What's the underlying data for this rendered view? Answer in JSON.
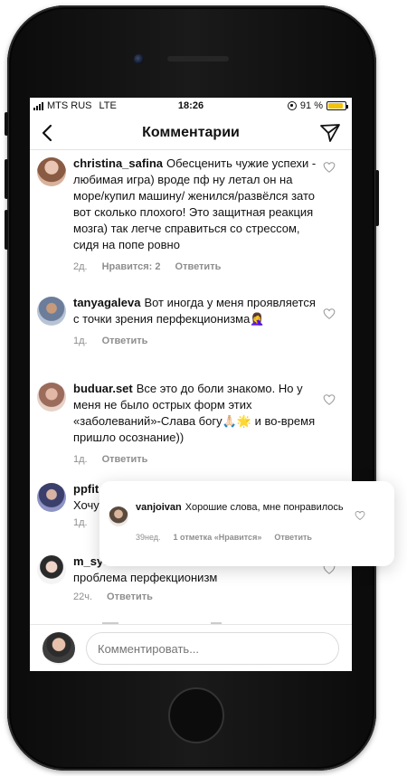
{
  "status_bar": {
    "carrier": "MTS RUS",
    "network": "LTE",
    "time": "18:26",
    "battery": "91 %",
    "battery_level": 0.91
  },
  "header": {
    "title": "Комментарии"
  },
  "comments": [
    {
      "username": "christina_safina",
      "text": "Обесценить чужие успехи - любимая игра) вроде пф ну летал он на море/купил машину/ женился/развёлся зато вот сколько плохого! Это защитная реакция мозга) так легче справиться со стрессом, сидя на попе ровно",
      "time": "2д.",
      "likes": "Нравится: 2",
      "reply": "Ответить"
    },
    {
      "username": "tanyagaleva",
      "text": "Вот иногда у меня проявляется с точки зрения перфекционизма🤦‍♀️",
      "time": "1д.",
      "reply": "Ответить"
    },
    {
      "username": "buduar.set",
      "text": "Все это до боли знакомо. Но у меня не было острых форм этих «заболеваний»-Слава богу🙏🏻🌟 и во-время пришло осознание))",
      "time": "1д.",
      "reply": "Ответить"
    },
    {
      "username": "ppfit",
      "text": "Хочу",
      "time": "1д."
    },
    {
      "username": "m_sych",
      "text": "проблема перфекционизм",
      "time": "22ч.",
      "reply": "Ответить"
    }
  ],
  "popup": {
    "username": "vanjoivan",
    "text": "Хорошие слова, мне понравилось",
    "time": "39нед.",
    "likes": "1 отметка «Нравится»",
    "reply": "Ответить"
  },
  "input": {
    "placeholder": "Комментировать..."
  }
}
